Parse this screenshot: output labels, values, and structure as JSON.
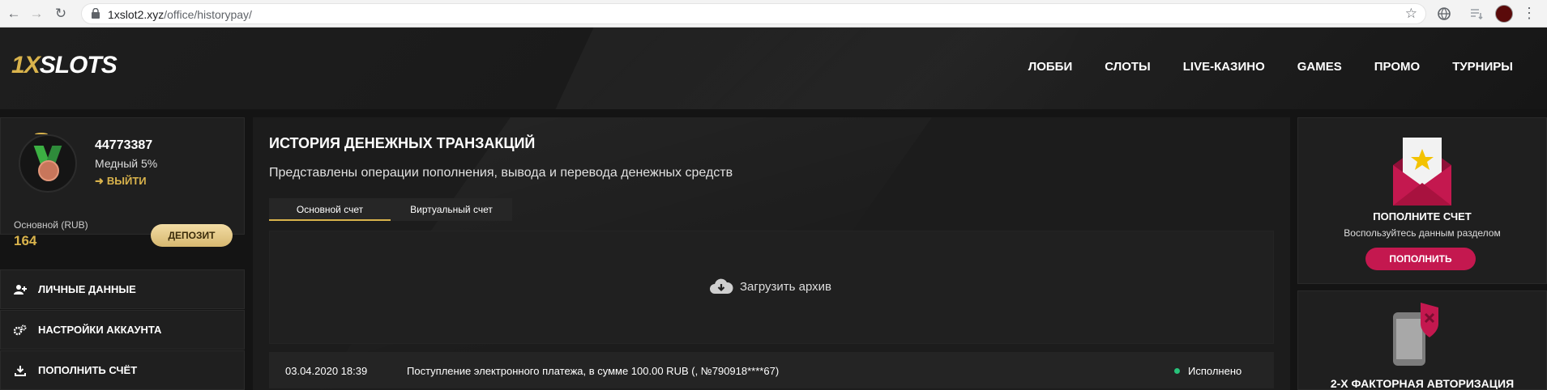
{
  "browser": {
    "url_domain": "1xslot2.xyz",
    "url_path": "/office/historypay/",
    "icons": [
      "back-icon",
      "forward-icon",
      "reload-icon",
      "lock-icon",
      "star-icon",
      "globe-icon",
      "playlist-icon",
      "menu-icon"
    ]
  },
  "header": {
    "logo_one": "1",
    "logo_x": "X",
    "logo_slots": "SLOTS",
    "nav": [
      "ЛОББИ",
      "СЛОТЫ",
      "LIVE-КАЗИНО",
      "GAMES",
      "ПРОМО",
      "ТУРНИРЫ"
    ]
  },
  "profile": {
    "user_id": "44773387",
    "level": "Медный 5%",
    "logout_label": "ВЫЙТИ",
    "balance_label": "Основной (RUB)",
    "balance_value": "164",
    "deposit_label": "ДЕПОЗИТ"
  },
  "sidebar": {
    "items": [
      {
        "label": "ЛИЧНЫЕ ДАННЫЕ",
        "icon": "user-add-icon"
      },
      {
        "label": "НАСТРОЙКИ АККАУНТА",
        "icon": "gears-icon"
      },
      {
        "label": "ПОПОЛНИТЬ СЧЁТ",
        "icon": "download-icon"
      }
    ]
  },
  "main": {
    "title": "ИСТОРИЯ ДЕНЕЖНЫХ ТРАНЗАКЦИЙ",
    "subtitle": "Представлены операции пополнения, вывода и перевода денежных средств",
    "tabs": [
      {
        "label": "Основной счет",
        "active": true
      },
      {
        "label": "Виртуальный счет",
        "active": false
      }
    ],
    "archive_label": "Загрузить архив",
    "transactions": [
      {
        "date": "03.04.2020 18:39",
        "description": "Поступление электронного платежа, в сумме 100.00 RUB (, №790918****67)",
        "status": "Исполнено",
        "status_color": "#27c27a"
      }
    ]
  },
  "right": {
    "promo_title": "ПОПОЛНИТЕ СЧЕТ",
    "promo_subtitle": "Воспользуйтесь данным разделом",
    "promo_button": "ПОПОЛНИТЬ",
    "twofa_title": "2-Х ФАКТОРНАЯ АВТОРИЗАЦИЯ"
  },
  "colors": {
    "accent_gold": "#d9b34c",
    "accent_pink": "#c4184f",
    "background": "#141414"
  }
}
